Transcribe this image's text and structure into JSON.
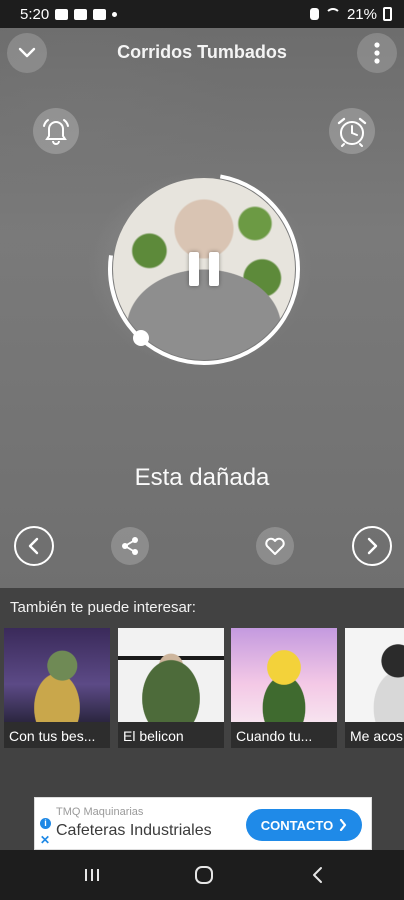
{
  "status_bar": {
    "time": "5:20",
    "battery": "21%"
  },
  "header": {
    "title": "Corridos Tumbados"
  },
  "player": {
    "track_title": "Esta dañada",
    "progress": 0.02
  },
  "suggestions": {
    "heading": "También te puede interesar:",
    "items": [
      {
        "label": "Con tus bes..."
      },
      {
        "label": "El belicon"
      },
      {
        "label": "Cuando tu..."
      },
      {
        "label": "Me acos"
      }
    ]
  },
  "ad": {
    "sponsor": "TMQ Maquinarias",
    "headline": "Cafeteras Industriales",
    "cta": "CONTACTO"
  },
  "colors": {
    "accent_blue": "#1f8ae8",
    "panel": "#424242",
    "bar": "#1d1d1d"
  }
}
